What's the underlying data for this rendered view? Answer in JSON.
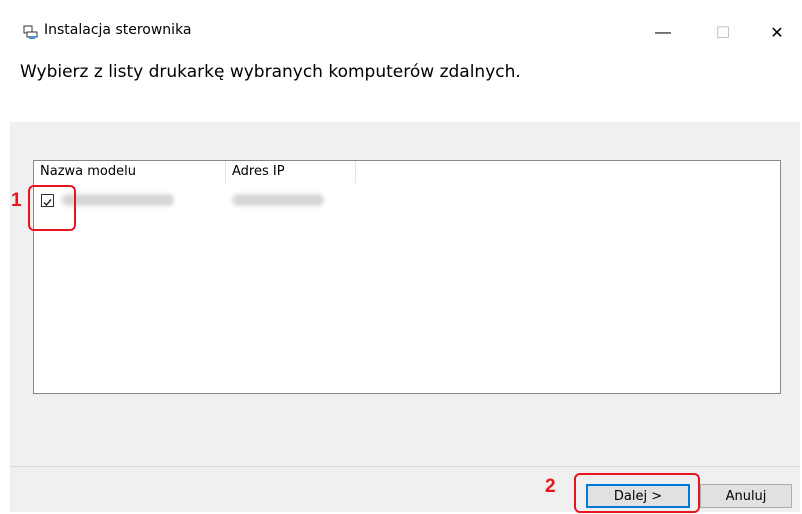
{
  "window": {
    "title": "Instalacja sterownika",
    "minimize_glyph": "—",
    "maximize_glyph": "☐",
    "close_glyph": "✕"
  },
  "header": {
    "instruction": "Wybierz z listy drukarkę wybranych komputerów zdalnych."
  },
  "list": {
    "columns": [
      "Nazwa modelu",
      "Adres IP"
    ],
    "rows": [
      {
        "checked": true
      }
    ]
  },
  "callouts": {
    "one": "1",
    "two": "2"
  },
  "buttons": {
    "next": "Dalej >",
    "cancel": "Anuluj"
  },
  "colors": {
    "highlight": "#e8141e",
    "default_button_border": "#0078d7"
  }
}
